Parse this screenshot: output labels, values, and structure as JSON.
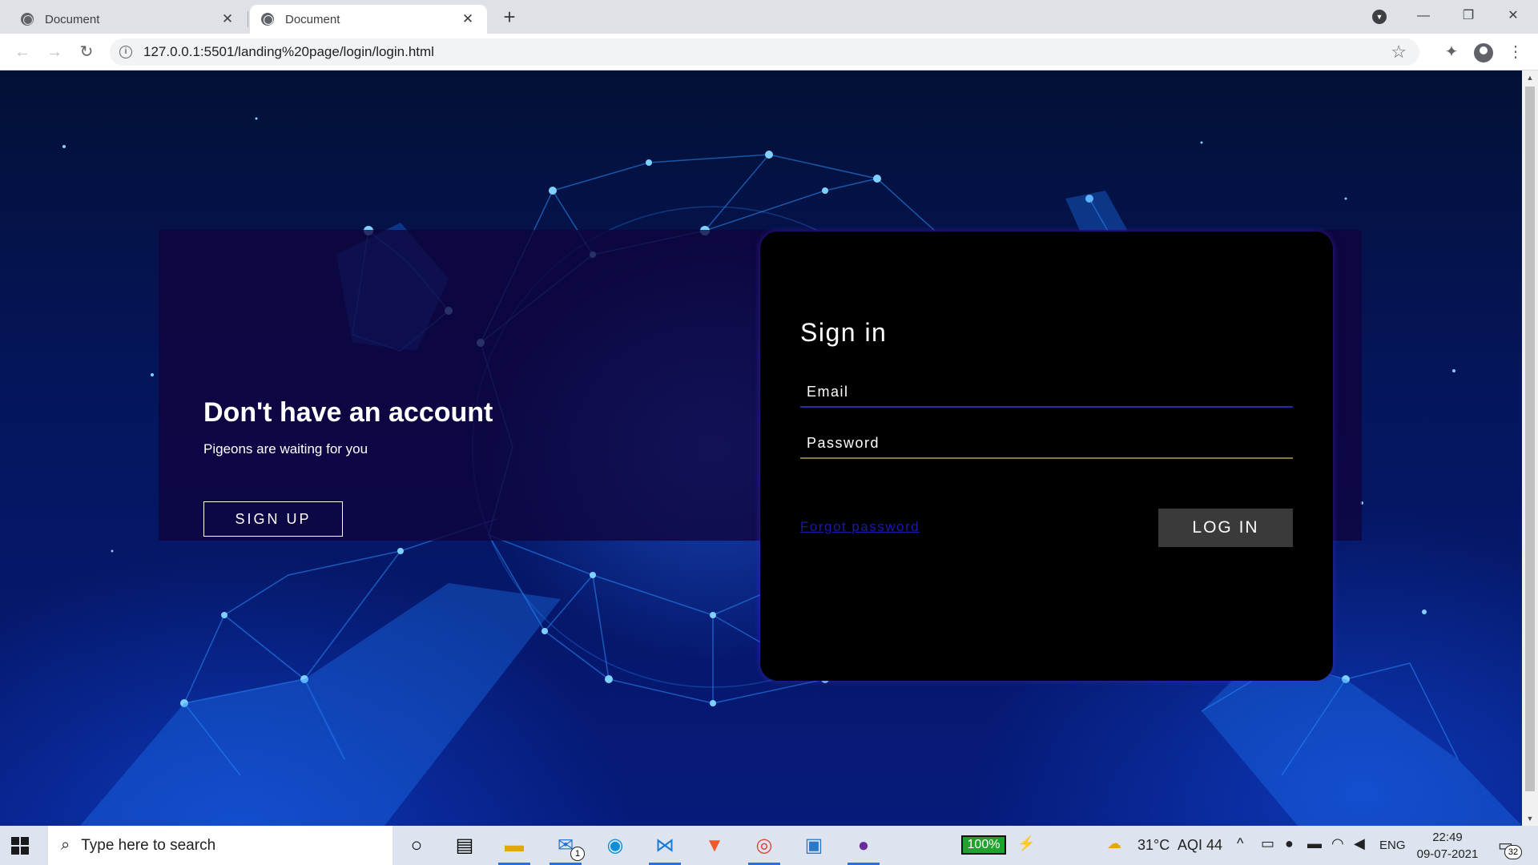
{
  "browser": {
    "tabs": [
      {
        "title": "Document",
        "active": false
      },
      {
        "title": "Document",
        "active": true
      }
    ],
    "new_tab": "+",
    "close_glyph": "✕",
    "url": "127.0.0.1:5501/landing%20page/login/login.html",
    "window_controls": {
      "minimize": "—",
      "restore": "❐",
      "close": "✕"
    }
  },
  "page": {
    "signup_panel": {
      "title": "Don't have an account",
      "subtitle": "Pigeons are waiting for you",
      "button": "SIGN UP"
    },
    "signin_panel": {
      "title": "Sign in",
      "email_placeholder": "Email",
      "password_placeholder": "Password",
      "forgot_link": "Forgot password",
      "login_button": "LOG IN"
    },
    "colors": {
      "card": "#000000",
      "forgot_link": "#1a1aa8",
      "login_button": "#3a3a3a"
    }
  },
  "taskbar": {
    "search_placeholder": "Type here to search",
    "mail_badge": "1",
    "battery": "100%",
    "weather": "31°C",
    "aqi": "AQI 44",
    "language": "ENG",
    "time": "22:49",
    "date": "09-07-2021",
    "notifications": "32",
    "apps": [
      "cortana-icon",
      "task-view-icon",
      "file-explorer-icon",
      "mail-icon",
      "edge-icon",
      "vscode-icon",
      "brave-icon",
      "chrome-icon",
      "photos-icon",
      "github-desktop-icon"
    ]
  }
}
